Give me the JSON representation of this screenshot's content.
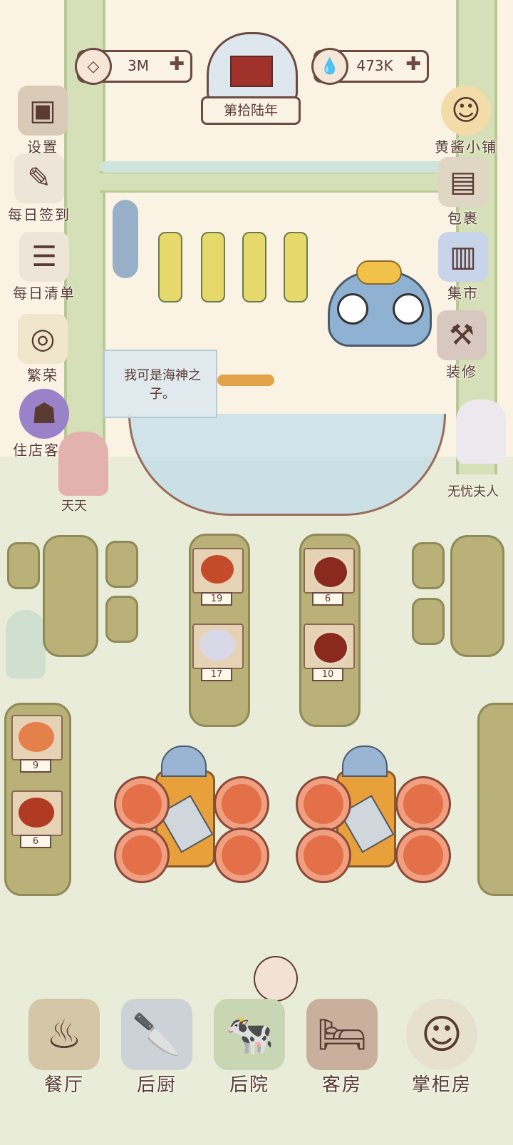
{
  "top_bar": {
    "coins": {
      "icon": "coin-icon",
      "value": "3M",
      "plus": "✚"
    },
    "year_label": "第拾陆年",
    "water": {
      "icon": "water-drop-icon",
      "value": "473K",
      "plus": "✚"
    }
  },
  "left_menu": [
    {
      "label": "设置",
      "icon": "settings-icon",
      "glyph": "▣"
    },
    {
      "label": "每日签到",
      "icon": "daily-checkin-icon",
      "glyph": "✎"
    },
    {
      "label": "每日清单",
      "icon": "daily-list-icon",
      "glyph": "☰"
    },
    {
      "label": "繁荣",
      "icon": "prosperity-icon",
      "glyph": "◎"
    },
    {
      "label": "住店客人",
      "icon": "guests-icon",
      "glyph": "☗"
    }
  ],
  "right_menu": [
    {
      "label": "黄酱小铺",
      "icon": "shop-icon",
      "glyph": "☺"
    },
    {
      "label": "包裹",
      "icon": "bag-icon",
      "glyph": "▤"
    },
    {
      "label": "集市",
      "icon": "market-icon",
      "glyph": "▥"
    },
    {
      "label": "装修",
      "icon": "decorate-icon",
      "glyph": "⚒"
    }
  ],
  "speech_bubble": "我可是海神之子。",
  "characters": {
    "left_guest": "天天",
    "right_guest": "无忧夫人"
  },
  "tables": [
    {
      "dishes": [
        {
          "count": "19"
        },
        {
          "count": "17"
        }
      ]
    },
    {
      "dishes": [
        {
          "count": "6"
        },
        {
          "count": "10"
        }
      ]
    },
    {
      "dishes": [
        {
          "count": "9"
        },
        {
          "count": "6"
        }
      ]
    }
  ],
  "bottom_nav": [
    {
      "label": "餐厅",
      "icon": "restaurant-icon",
      "glyph": "♨"
    },
    {
      "label": "后厨",
      "icon": "kitchen-icon",
      "glyph": "🔪"
    },
    {
      "label": "后院",
      "icon": "backyard-icon",
      "glyph": "🐄"
    },
    {
      "label": "客房",
      "icon": "guest-room-icon",
      "glyph": "🛏"
    },
    {
      "label": "掌柜房",
      "icon": "manager-room-icon",
      "glyph": "☺"
    }
  ],
  "colors": {
    "wall": "#faf3e3",
    "floor": "#e8ecd8",
    "pillar": "#d6e0b8",
    "text": "#5a3b33"
  }
}
